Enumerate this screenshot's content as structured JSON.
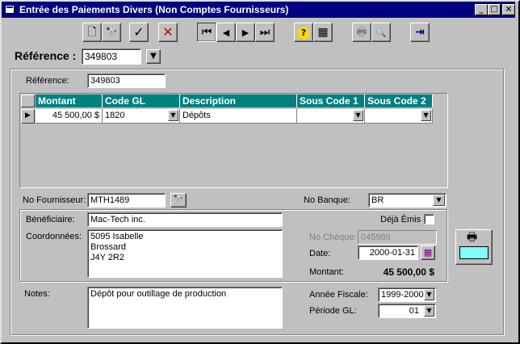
{
  "window": {
    "title": "Entrée des Paiements Divers (Non Comptes Fournisseurs)",
    "minimize": "_",
    "maximize": "□",
    "close": "×"
  },
  "toolbar": {
    "new_icon": "🗋",
    "find_icon": "🔭",
    "accept_icon": "✓",
    "cancel_icon": "✕",
    "first_icon": "⏮",
    "prev_icon": "◀",
    "next_icon": "▶",
    "last_icon": "⏭",
    "help_icon": "?",
    "calendar_icon": "▦",
    "print_icon": "🖶",
    "preview_icon": "🔍",
    "exit_icon": "⇥"
  },
  "header": {
    "reference_label": "Référence :",
    "reference_value": "349803"
  },
  "form": {
    "reference_label": "Référence:",
    "reference_value": "349803",
    "grid": {
      "columns": [
        "Montant",
        "Code GL",
        "Description",
        "Sous Code 1",
        "Sous Code 2"
      ],
      "rows": [
        {
          "montant": "45 500,00 $",
          "code_gl": "1820",
          "description": "Dépôts",
          "sous_code_1": "",
          "sous_code_2": ""
        }
      ]
    },
    "fournisseur_label": "No Fournisseur:",
    "fournisseur_value": "MTH1489",
    "banque_label": "No Banque:",
    "banque_value": "BR",
    "beneficiaire_label": "Bénéficiaire:",
    "beneficiaire_value": "Mac-Tech inc.",
    "coordonnees_label": "Coordonnées:",
    "coordonnees_lines": [
      "5095 Isabelle",
      "Brossard",
      "J4Y 2R2"
    ],
    "deja_emis_label": "Déjà Émis",
    "no_cheque_label": "No Chèque:",
    "no_cheque_value": "045989",
    "date_label": "Date:",
    "date_value": "2000-01-31",
    "montant_label": "Montant:",
    "montant_value": "45 500,00 $",
    "notes_label": "Notes:",
    "notes_value": "Dépôt pour outillage de production",
    "annee_label": "Année Fiscale:",
    "annee_value": "1999-2000",
    "periode_label": "Période GL:",
    "periode_value": "01"
  },
  "colors": {
    "title_bar": "#000080",
    "grid_header": "#008080",
    "face": "#c0c0c0"
  }
}
